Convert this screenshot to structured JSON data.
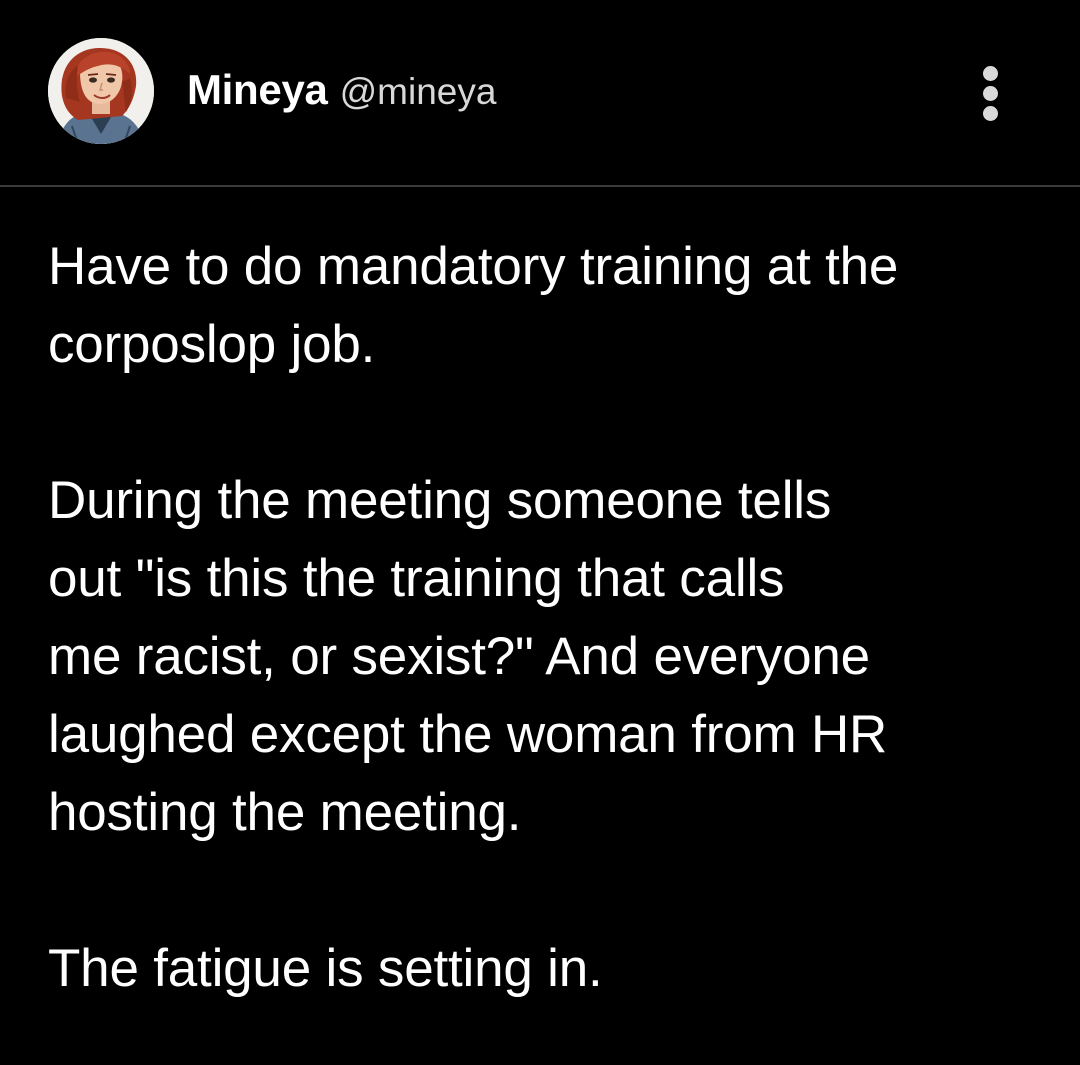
{
  "post": {
    "author": {
      "display_name": "Mineya",
      "handle": "@mineya",
      "avatar_icon": "cartoon-avatar-red-hair"
    },
    "menu_icon": "more-vertical-icon",
    "paragraphs": [
      "Have to do mandatory training at the\ncorposlop job.",
      "During the meeting someone tells\nout \"is this the training that calls\nme racist, or sexist?\" And everyone\nlaughed except the woman from HR\nhosting the meeting.",
      "The fatigue is setting in."
    ]
  },
  "colors": {
    "background": "#000000",
    "text": "#ffffff",
    "handle": "#d8d8d8",
    "divider": "#3a3a3a",
    "menu_dots": "#d9d9d9"
  }
}
